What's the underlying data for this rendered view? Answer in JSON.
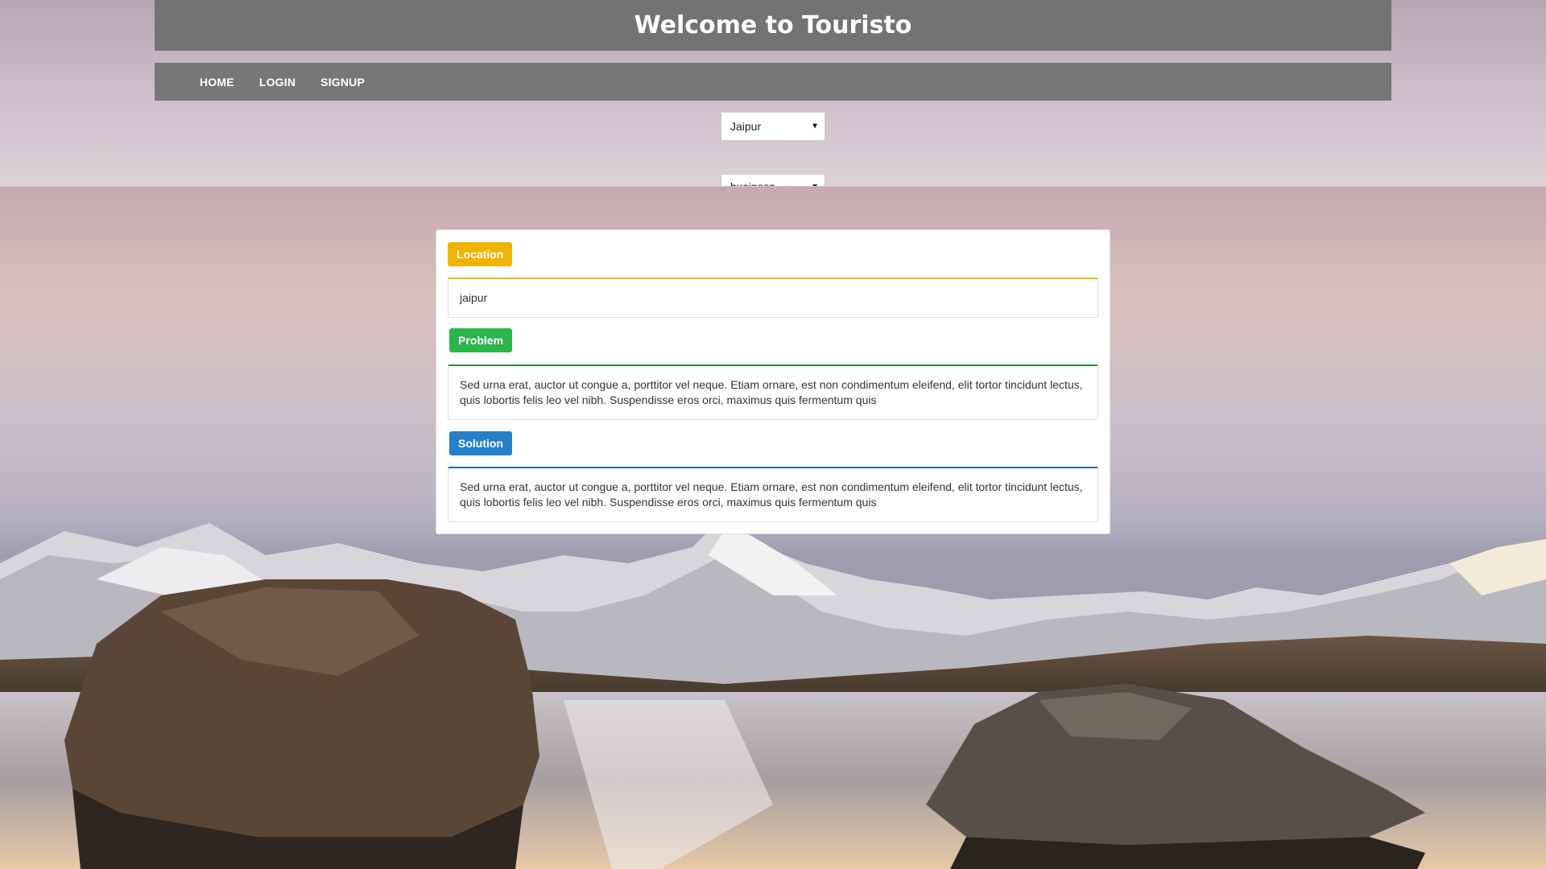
{
  "header": {
    "title": "Welcome to Touristo"
  },
  "nav": {
    "items": [
      {
        "label": "HOME"
      },
      {
        "label": "LOGIN"
      },
      {
        "label": "SIGNUP"
      }
    ]
  },
  "filters": {
    "city": {
      "selected": "Jaipur"
    },
    "type": {
      "selected": "business"
    }
  },
  "card": {
    "location": {
      "label": "Location",
      "value": "jaipur"
    },
    "problem": {
      "label": "Problem",
      "text": "Sed urna erat, auctor ut congue a, porttitor vel neque. Etiam ornare, est non condimentum eleifend, elit tortor tincidunt lectus, quis lobortis felis leo vel nibh. Suspendisse eros orci, maximus quis fermentum quis"
    },
    "solution": {
      "label": "Solution",
      "text": "Sed urna erat, auctor ut congue a, porttitor vel neque. Etiam ornare, est non condimentum eleifend, elit tortor tincidunt lectus, quis lobortis felis leo vel nibh. Suspendisse eros orci, maximus quis fermentum quis"
    }
  },
  "colors": {
    "header_bg": "#737373",
    "location_accent": "#f0b400",
    "problem_accent": "#2bb64c",
    "solution_accent": "#2580c9"
  },
  "icons": {
    "dropdown": "caret-down-icon",
    "background": "mountain-lake-photo"
  }
}
